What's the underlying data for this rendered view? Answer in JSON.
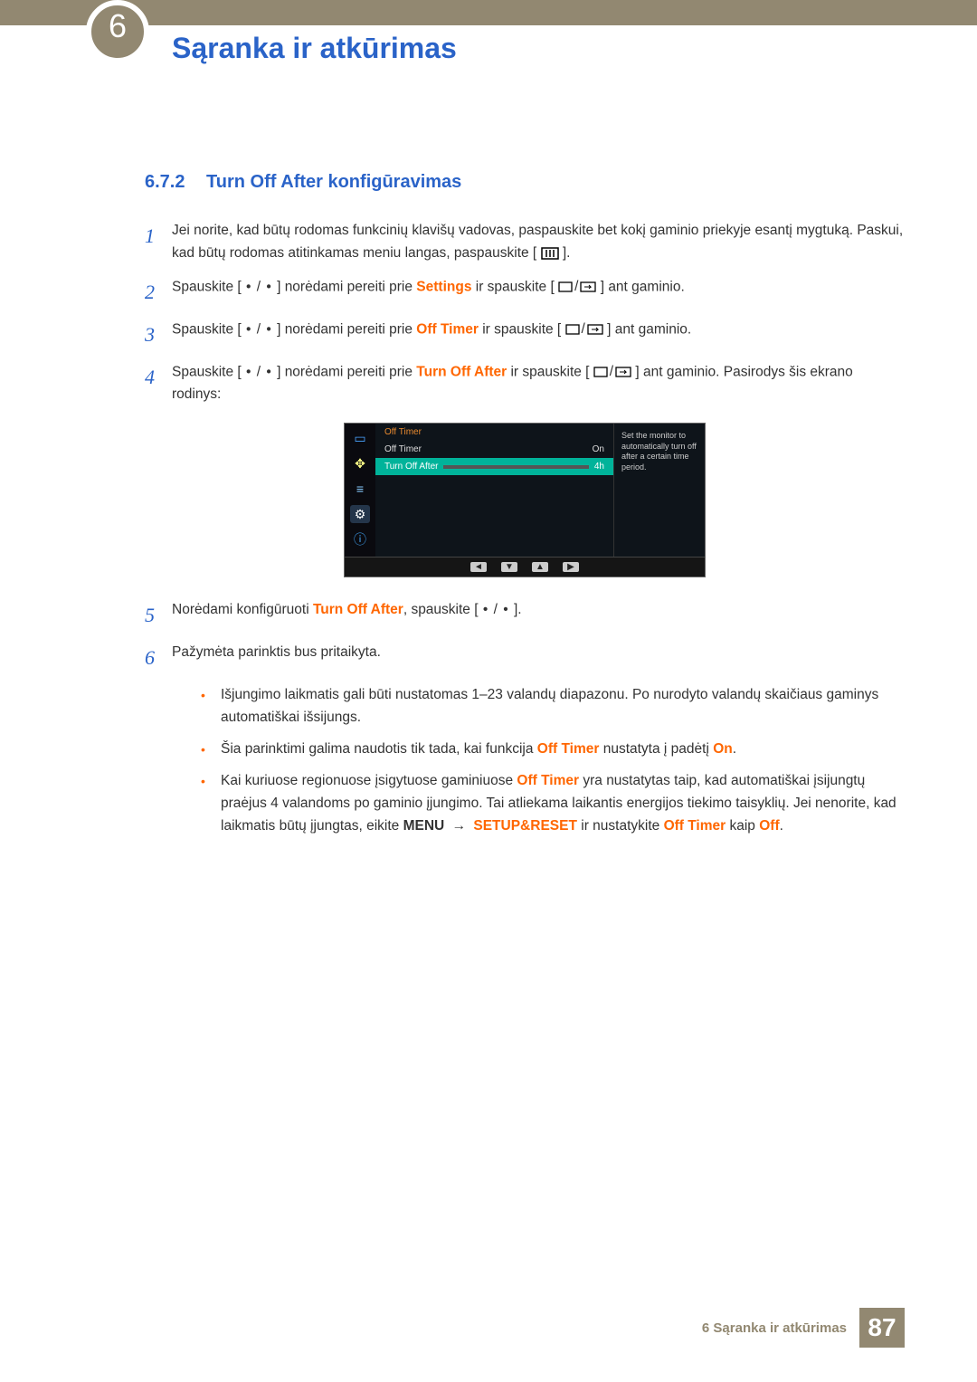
{
  "chapter": {
    "number": "6",
    "title": "Sąranka ir atkūrimas"
  },
  "section": {
    "number": "6.7.2",
    "title": "Turn Off After konfigūravimas"
  },
  "steps": [
    {
      "n": "1",
      "pre": "Jei norite, kad būtų rodomas funkcinių klavišų vadovas, paspauskite bet kokį gaminio priekyje esantį mygtuką. Paskui, kad būtų rodomas atitinkamas meniu langas, paspauskite [",
      "post": "]."
    },
    {
      "n": "2",
      "pre": "Spauskite [",
      "mid1": "] norėdami pereiti prie ",
      "hl": "Settings",
      "mid2": " ir spauskite [",
      "post": "] ant gaminio."
    },
    {
      "n": "3",
      "pre": "Spauskite [",
      "mid1": "] norėdami pereiti prie ",
      "hl": "Off Timer",
      "mid2": " ir spauskite [",
      "post": "] ant gaminio."
    },
    {
      "n": "4",
      "pre": "Spauskite [",
      "mid1": "] norėdami pereiti prie ",
      "hl": "Turn Off After",
      "mid2": " ir spauskite [",
      "post": "] ant gaminio. Pasirodys šis ekrano rodinys:"
    },
    {
      "n": "5",
      "pre": "Norėdami konfigūruoti ",
      "hl": "Turn Off After",
      "mid": ", spauskite [",
      "post": "]."
    },
    {
      "n": "6",
      "text": "Pažymėta parinktis bus pritaikyta."
    }
  ],
  "osd": {
    "menu_title": "Off Timer",
    "row1_label": "Off Timer",
    "row1_value": "On",
    "row2_label": "Turn Off After",
    "row2_value": "4h",
    "tip": "Set the monitor to automatically turn off after a certain time period.",
    "nav": [
      "◄",
      "▼",
      "▲",
      "▶"
    ]
  },
  "notes": [
    {
      "text": "Išjungimo laikmatis gali būti nustatomas 1–23 valandų diapazonu. Po nurodyto valandų skaičiaus gaminys automatiškai išsijungs."
    },
    {
      "pre": "Šia parinktimi galima naudotis tik tada, kai funkcija ",
      "hl1": "Off Timer",
      "mid": " nustatyta į padėtį ",
      "hl2": "On",
      "post": "."
    },
    {
      "pre": "Kai kuriuose regionuose įsigytuose gaminiuose ",
      "hl1": "Off Timer",
      "mid1": " yra nustatytas taip, kad automatiškai įsijungtų praėjus 4 valandoms po gaminio įjungimo. Tai atliekama laikantis energijos tiekimo taisyklių. Jei nenorite, kad laikmatis būtų įjungtas, eikite ",
      "b1": "MENU",
      "arrow": "→",
      "b2": "SETUP&RESET",
      "mid2": " ir nustatykite ",
      "hl2": "Off Timer",
      "mid3": " kaip ",
      "hl3": "Off",
      "post": "."
    }
  ],
  "footer": {
    "text": "6 Sąranka ir atkūrimas",
    "page": "87"
  },
  "glyphs": {
    "dot_slash_dot": " • / • "
  }
}
